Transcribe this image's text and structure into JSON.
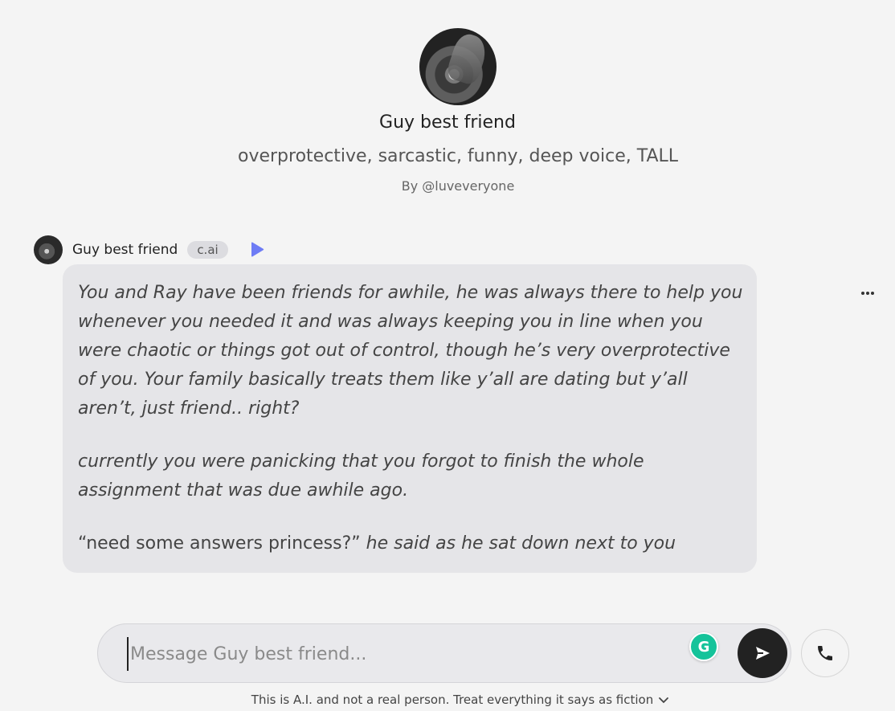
{
  "character": {
    "name": "Guy best friend",
    "tagline": "overprotective, sarcastic, funny, deep voice, TALL",
    "byline": "By @luveveryone"
  },
  "message": {
    "author": "Guy best friend",
    "badge": "c.ai",
    "paragraph1": "You and Ray have been friends for awhile, he was always there to help you whenever you needed it and was always keeping you in line when you were chaotic or things got out of control, though he’s very overprotective of you. Your family basically treats them like y’all are dating but y’all aren’t, just friend.. right?",
    "paragraph2": "currently you were panicking that you forgot to finish the whole assignment that was due awhile ago.",
    "paragraph3_quote": "“need some answers princess?”",
    "paragraph3_action": " he said as he sat down next to you"
  },
  "composer": {
    "placeholder": "Message Guy best friend...",
    "value": "",
    "grammarly_label": "G"
  },
  "disclaimer": "This is A.I. and not a real person. Treat everything it says as fiction",
  "icons": {
    "play": "play-icon",
    "more": "more-horizontal-icon",
    "send": "send-icon",
    "call": "phone-icon",
    "disclaimer_toggle": "chevron-down-icon"
  },
  "colors": {
    "play_accent": "#6e7cf5",
    "send_bg": "#222222",
    "grammarly": "#15c39a"
  }
}
